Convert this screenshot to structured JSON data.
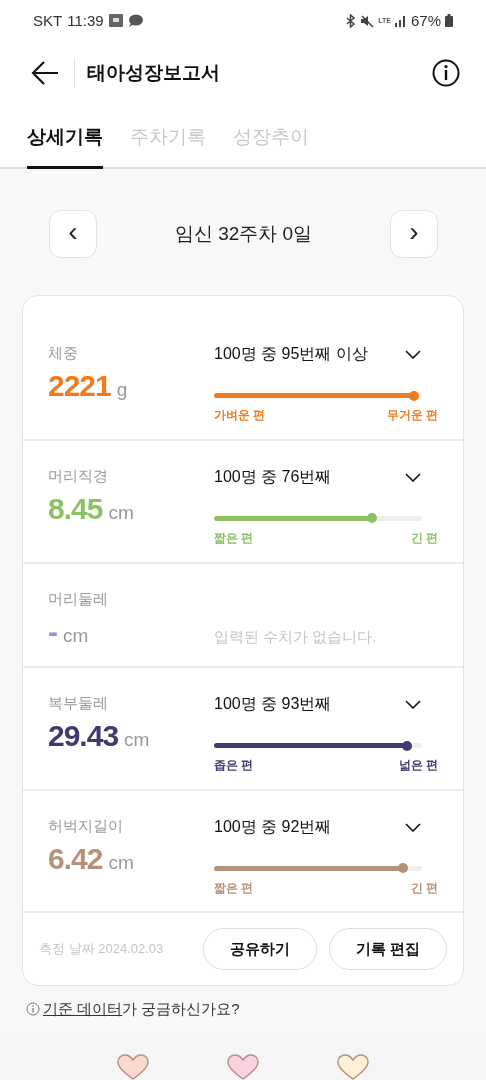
{
  "status_bar": {
    "carrier": "SKT",
    "time": "11:39",
    "network": "LTE",
    "battery": "67%"
  },
  "header": {
    "title": "태아성장보고서"
  },
  "tabs": [
    {
      "label": "상세기록",
      "selected": true
    },
    {
      "label": "주차기록",
      "selected": false
    },
    {
      "label": "성장추이",
      "selected": false
    }
  ],
  "week_nav": {
    "prev": "‹",
    "label": "임신 32주차 0일",
    "next": "›"
  },
  "measurements": [
    {
      "kind": "measure",
      "name": "체중",
      "value": "2221",
      "unit": "g",
      "rank": "100명 중 95번째 이상",
      "level": 0.96,
      "low_label": "가벼운 편",
      "high_label": "무거운 편",
      "color": "#f07a1e"
    },
    {
      "kind": "measure",
      "name": "머리직경",
      "value": "8.45",
      "unit": "cm",
      "rank": "100명 중 76번째",
      "level": 0.76,
      "low_label": "짧은 편",
      "high_label": "긴 편",
      "color": "#8cc063"
    },
    {
      "kind": "empty",
      "name": "머리둘레",
      "value": "-",
      "unit": "cm",
      "message": "입력된 수치가 없습니다.",
      "color": "#7d9ccc"
    },
    {
      "kind": "measure",
      "name": "복부둘레",
      "value": "29.43",
      "unit": "cm",
      "rank": "100명 중 93번째",
      "level": 0.93,
      "low_label": "좁은 편",
      "high_label": "넓은 편",
      "color": "#3f3a72"
    },
    {
      "kind": "measure",
      "name": "허벅지길이",
      "value": "6.42",
      "unit": "cm",
      "rank": "100명 중 92번째",
      "level": 0.91,
      "low_label": "짧은 편",
      "high_label": "긴 편",
      "color": "#b4917a"
    }
  ],
  "record_footer": {
    "date": "측정 날짜 2024.02.03",
    "buttons": [
      "공유하기",
      "기록 편집"
    ]
  },
  "help": {
    "link": "기준 데이터",
    "text": "가 궁금하신가요?"
  },
  "bottom_nav": [
    {
      "color": "#fbdacd"
    },
    {
      "color": "#f9d2dd"
    },
    {
      "color": "#fdf0d5"
    }
  ]
}
